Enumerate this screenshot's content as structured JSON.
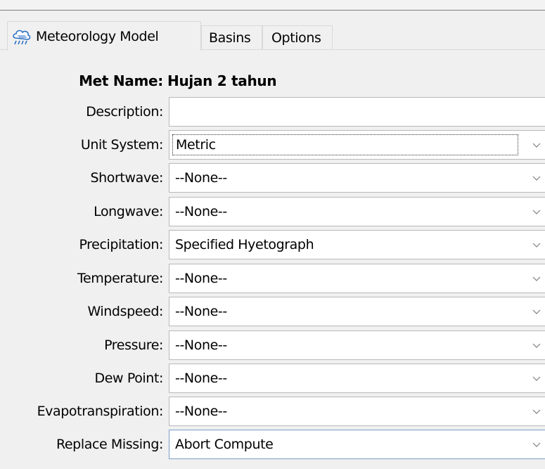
{
  "tabs": [
    {
      "label": "Meteorology Model",
      "icon": "weather-cloud-icon",
      "active": true
    },
    {
      "label": "Basins",
      "active": false
    },
    {
      "label": "Options",
      "active": false
    }
  ],
  "met_name": {
    "label": "Met Name:",
    "value": "Hujan 2 tahun"
  },
  "fields": {
    "description": {
      "label": "Description:",
      "value": ""
    },
    "unit_system": {
      "label": "Unit System:",
      "value": "Metric"
    },
    "shortwave": {
      "label": "Shortwave:",
      "value": "--None--"
    },
    "longwave": {
      "label": "Longwave:",
      "value": "--None--"
    },
    "precipitation": {
      "label": "Precipitation:",
      "value": "Specified Hyetograph"
    },
    "temperature": {
      "label": "Temperature:",
      "value": "--None--"
    },
    "windspeed": {
      "label": "Windspeed:",
      "value": "--None--"
    },
    "pressure": {
      "label": "Pressure:",
      "value": "--None--"
    },
    "dew_point": {
      "label": "Dew Point:",
      "value": "--None--"
    },
    "evapotranspiration": {
      "label": "Evapotranspiration:",
      "value": "--None--"
    },
    "replace_missing": {
      "label": "Replace Missing:",
      "value": "Abort Compute"
    }
  },
  "colors": {
    "background": "#f0f0f0",
    "field_border": "#b9b9b9",
    "selected_border": "#7a9cc7",
    "icon_blue": "#2b6fc4"
  }
}
